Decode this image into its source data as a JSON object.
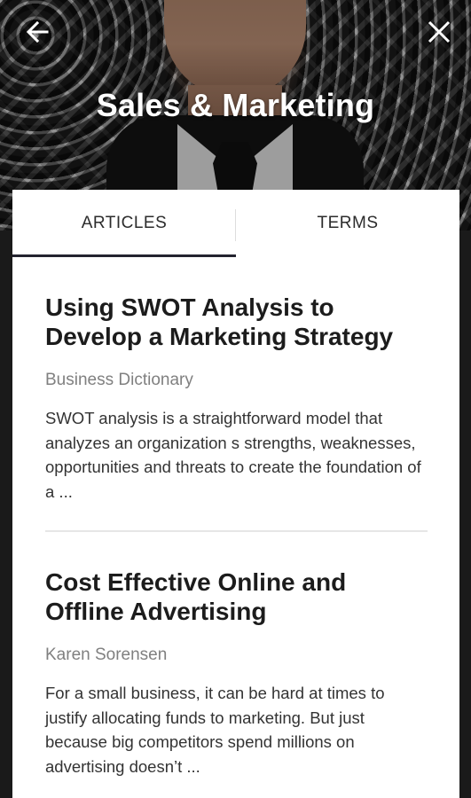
{
  "header": {
    "title": "Sales & Marketing",
    "back_icon": "arrow-left-icon",
    "close_icon": "close-icon"
  },
  "tabs": [
    {
      "label": "ARTICLES",
      "selected": true
    },
    {
      "label": "TERMS",
      "selected": false
    }
  ],
  "articles": [
    {
      "title": "Using SWOT Analysis to Develop a Marketing Strategy",
      "author": "Business Dictionary",
      "excerpt": "SWOT analysis is a straightforward model that analyzes an organization s strengths, weaknesses, opportunities and threats to create the foundation of a ..."
    },
    {
      "title": "Cost Effective Online and Offline Advertising",
      "author": "Karen Sorensen",
      "excerpt": "For a small business, it can be hard at times to justify allocating funds to marketing. But just because big competitors spend millions on advertising doesn’t ..."
    }
  ],
  "colors": {
    "tab_indicator": "#23232f",
    "author_text": "#808080"
  }
}
